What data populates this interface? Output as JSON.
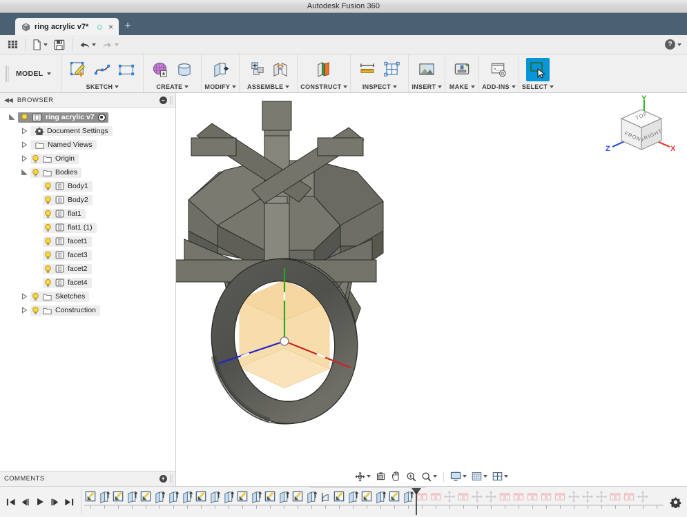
{
  "window": {
    "title": "Autodesk Fusion 360"
  },
  "tabs": {
    "items": [
      {
        "label": "ring acrylic v7*",
        "icon": "cube-icon",
        "modified": true,
        "sync": "sync-dot-icon",
        "close": "×"
      }
    ],
    "new_tab_label": "+"
  },
  "quick_access": {
    "buttons": [
      {
        "name": "show-data-panel",
        "icon": "grid-icon",
        "caret": false
      },
      {
        "name": "file",
        "icon": "file-icon",
        "caret": true
      },
      {
        "name": "save",
        "icon": "save-icon",
        "caret": false
      },
      {
        "name": "undo",
        "icon": "undo-arrow-icon",
        "caret": true
      },
      {
        "name": "redo",
        "icon": "redo-arrow-icon",
        "caret": true,
        "disabled": true
      }
    ],
    "help": {
      "label": "?",
      "caret": true
    }
  },
  "ribbon": {
    "workspace": {
      "label": "MODEL",
      "caret": true
    },
    "groups": [
      {
        "label": "SKETCH",
        "caret": true,
        "buttons": [
          "create-sketch-icon",
          "spline-icon",
          "rectangle-icon"
        ]
      },
      {
        "label": "CREATE",
        "caret": true,
        "buttons": [
          "form-mesh-icon",
          "cylinder-extrude-icon"
        ]
      },
      {
        "label": "MODIFY",
        "caret": true,
        "buttons": [
          "press-pull-icon"
        ]
      },
      {
        "label": "ASSEMBLE",
        "caret": true,
        "buttons": [
          "new-component-icon",
          "joint-icon"
        ]
      },
      {
        "label": "CONSTRUCT",
        "caret": true,
        "buttons": [
          "offset-plane-icon"
        ]
      },
      {
        "label": "INSPECT",
        "caret": true,
        "buttons": [
          "measure-icon",
          "section-analysis-icon"
        ]
      },
      {
        "label": "INSERT",
        "caret": true,
        "buttons": [
          "insert-image-icon"
        ]
      },
      {
        "label": "MAKE",
        "caret": true,
        "buttons": [
          "3d-print-icon"
        ]
      },
      {
        "label": "ADD-INS",
        "caret": true,
        "buttons": [
          "scripts-addins-icon"
        ]
      },
      {
        "label": "SELECT",
        "caret": true,
        "buttons": [
          "select-window-icon"
        ],
        "selected": true
      }
    ]
  },
  "browser": {
    "header": {
      "title": "BROWSER",
      "collapse_icon": "double-chevron-left-icon",
      "menu_icon": "minus-circle-icon"
    },
    "tree": [
      {
        "label": "ring acrylic v7",
        "depth": 0,
        "expander": "expanded",
        "bulb": true,
        "icon": "component-icon",
        "root": true,
        "radio": true
      },
      {
        "label": "Document Settings",
        "depth": 1,
        "expander": "collapsed",
        "bulb": false,
        "icon": "gear-icon"
      },
      {
        "label": "Named Views",
        "depth": 1,
        "expander": "collapsed",
        "bulb": false,
        "icon": "folder-icon"
      },
      {
        "label": "Origin",
        "depth": 1,
        "expander": "collapsed",
        "bulb": true,
        "icon": "folder-icon"
      },
      {
        "label": "Bodies",
        "depth": 1,
        "expander": "expanded",
        "bulb": true,
        "icon": "folder-icon"
      },
      {
        "label": "Body1",
        "depth": 2,
        "expander": "none",
        "bulb": true,
        "icon": "body-icon"
      },
      {
        "label": "Body2",
        "depth": 2,
        "expander": "none",
        "bulb": true,
        "icon": "body-icon"
      },
      {
        "label": "flat1",
        "depth": 2,
        "expander": "none",
        "bulb": true,
        "icon": "body-icon"
      },
      {
        "label": "flat1 (1)",
        "depth": 2,
        "expander": "none",
        "bulb": true,
        "icon": "body-icon"
      },
      {
        "label": "facet1",
        "depth": 2,
        "expander": "none",
        "bulb": true,
        "icon": "body-icon"
      },
      {
        "label": "facet3",
        "depth": 2,
        "expander": "none",
        "bulb": true,
        "icon": "body-icon"
      },
      {
        "label": "facet2",
        "depth": 2,
        "expander": "none",
        "bulb": true,
        "icon": "body-icon"
      },
      {
        "label": "facet4",
        "depth": 2,
        "expander": "none",
        "bulb": true,
        "icon": "body-icon"
      },
      {
        "label": "Sketches",
        "depth": 1,
        "expander": "collapsed",
        "bulb": true,
        "icon": "folder-icon"
      },
      {
        "label": "Construction",
        "depth": 1,
        "expander": "collapsed",
        "bulb": true,
        "icon": "folder-icon"
      }
    ],
    "comments": {
      "title": "COMMENTS",
      "add_icon": "plus-circle-icon"
    }
  },
  "canvas": {
    "model_name": "ring acrylic v7",
    "view_cube": {
      "faces": {
        "top": "TOP",
        "front": "FRONT",
        "right": "RIGHT"
      },
      "axes": [
        {
          "label": "X",
          "color": "#e8382b"
        },
        {
          "label": "Y",
          "color": "#2fb824"
        },
        {
          "label": "Z",
          "color": "#2b4be8"
        }
      ]
    },
    "origin_axes": [
      {
        "name": "x-axis",
        "color": "#cc2222"
      },
      {
        "name": "y-axis",
        "color": "#22aa22"
      },
      {
        "name": "z-axis",
        "color": "#2222cc"
      }
    ],
    "colors": {
      "body_dark": "#6b6b63",
      "body_mid": "#7e7e76",
      "body_light": "#9b9b92",
      "body_shadow": "#545450",
      "plane_fill": "#f8d79a",
      "background": "#ffffff"
    }
  },
  "navigation_bar": {
    "buttons": [
      {
        "name": "orbit-icon",
        "caret": true
      },
      {
        "name": "look-at-icon",
        "caret": false
      },
      {
        "name": "pan-hand-icon",
        "caret": false
      },
      {
        "name": "zoom-window-icon",
        "caret": false
      },
      {
        "name": "zoom-icon",
        "caret": true
      },
      {
        "name": "display-settings-icon",
        "caret": true
      },
      {
        "name": "grid-snaps-icon",
        "caret": true
      },
      {
        "name": "viewports-icon",
        "caret": true
      }
    ]
  },
  "timeline": {
    "playback": [
      {
        "name": "go-to-beginning-button",
        "icon": "skip-start-icon"
      },
      {
        "name": "step-back-button",
        "icon": "step-back-icon"
      },
      {
        "name": "play-button",
        "icon": "play-icon"
      },
      {
        "name": "step-forward-button",
        "icon": "step-forward-icon"
      },
      {
        "name": "go-to-end-button",
        "icon": "skip-end-icon"
      }
    ],
    "features": [
      {
        "type": "sketch",
        "state": "active"
      },
      {
        "type": "extrude",
        "state": "active"
      },
      {
        "type": "sketch",
        "state": "active"
      },
      {
        "type": "extrude",
        "state": "active"
      },
      {
        "type": "sketch",
        "state": "active"
      },
      {
        "type": "extrude",
        "state": "active"
      },
      {
        "type": "extrude",
        "state": "active"
      },
      {
        "type": "extrude",
        "state": "active"
      },
      {
        "type": "sketch",
        "state": "active"
      },
      {
        "type": "extrude",
        "state": "active"
      },
      {
        "type": "extrude",
        "state": "active"
      },
      {
        "type": "sketch",
        "state": "active"
      },
      {
        "type": "extrude",
        "state": "active"
      },
      {
        "type": "sketch",
        "state": "active"
      },
      {
        "type": "extrude",
        "state": "active"
      },
      {
        "type": "sketch",
        "state": "active"
      },
      {
        "type": "extrude",
        "state": "active"
      },
      {
        "type": "revolve",
        "state": "active"
      },
      {
        "type": "sketch",
        "state": "active"
      },
      {
        "type": "extrude",
        "state": "active"
      },
      {
        "type": "sketch",
        "state": "active"
      },
      {
        "type": "extrude",
        "state": "active"
      },
      {
        "type": "sketch",
        "state": "active"
      },
      {
        "type": "extrude",
        "state": "active"
      },
      {
        "type": "pattern",
        "state": "rolled-back"
      },
      {
        "type": "pattern",
        "state": "rolled-back"
      },
      {
        "type": "move",
        "state": "rolled-back"
      },
      {
        "type": "pattern",
        "state": "rolled-back"
      },
      {
        "type": "move",
        "state": "rolled-back"
      },
      {
        "type": "move",
        "state": "rolled-back"
      },
      {
        "type": "pattern",
        "state": "rolled-back"
      },
      {
        "type": "pattern",
        "state": "rolled-back"
      },
      {
        "type": "pattern",
        "state": "rolled-back"
      },
      {
        "type": "pattern",
        "state": "rolled-back"
      },
      {
        "type": "pattern",
        "state": "rolled-back"
      },
      {
        "type": "move",
        "state": "rolled-back"
      },
      {
        "type": "move",
        "state": "rolled-back"
      },
      {
        "type": "move",
        "state": "rolled-back"
      },
      {
        "type": "pattern",
        "state": "rolled-back"
      },
      {
        "type": "pattern",
        "state": "rolled-back"
      },
      {
        "type": "move",
        "state": "rolled-back"
      }
    ],
    "marker_position_index": 24,
    "settings": {
      "name": "timeline-settings-icon"
    }
  }
}
